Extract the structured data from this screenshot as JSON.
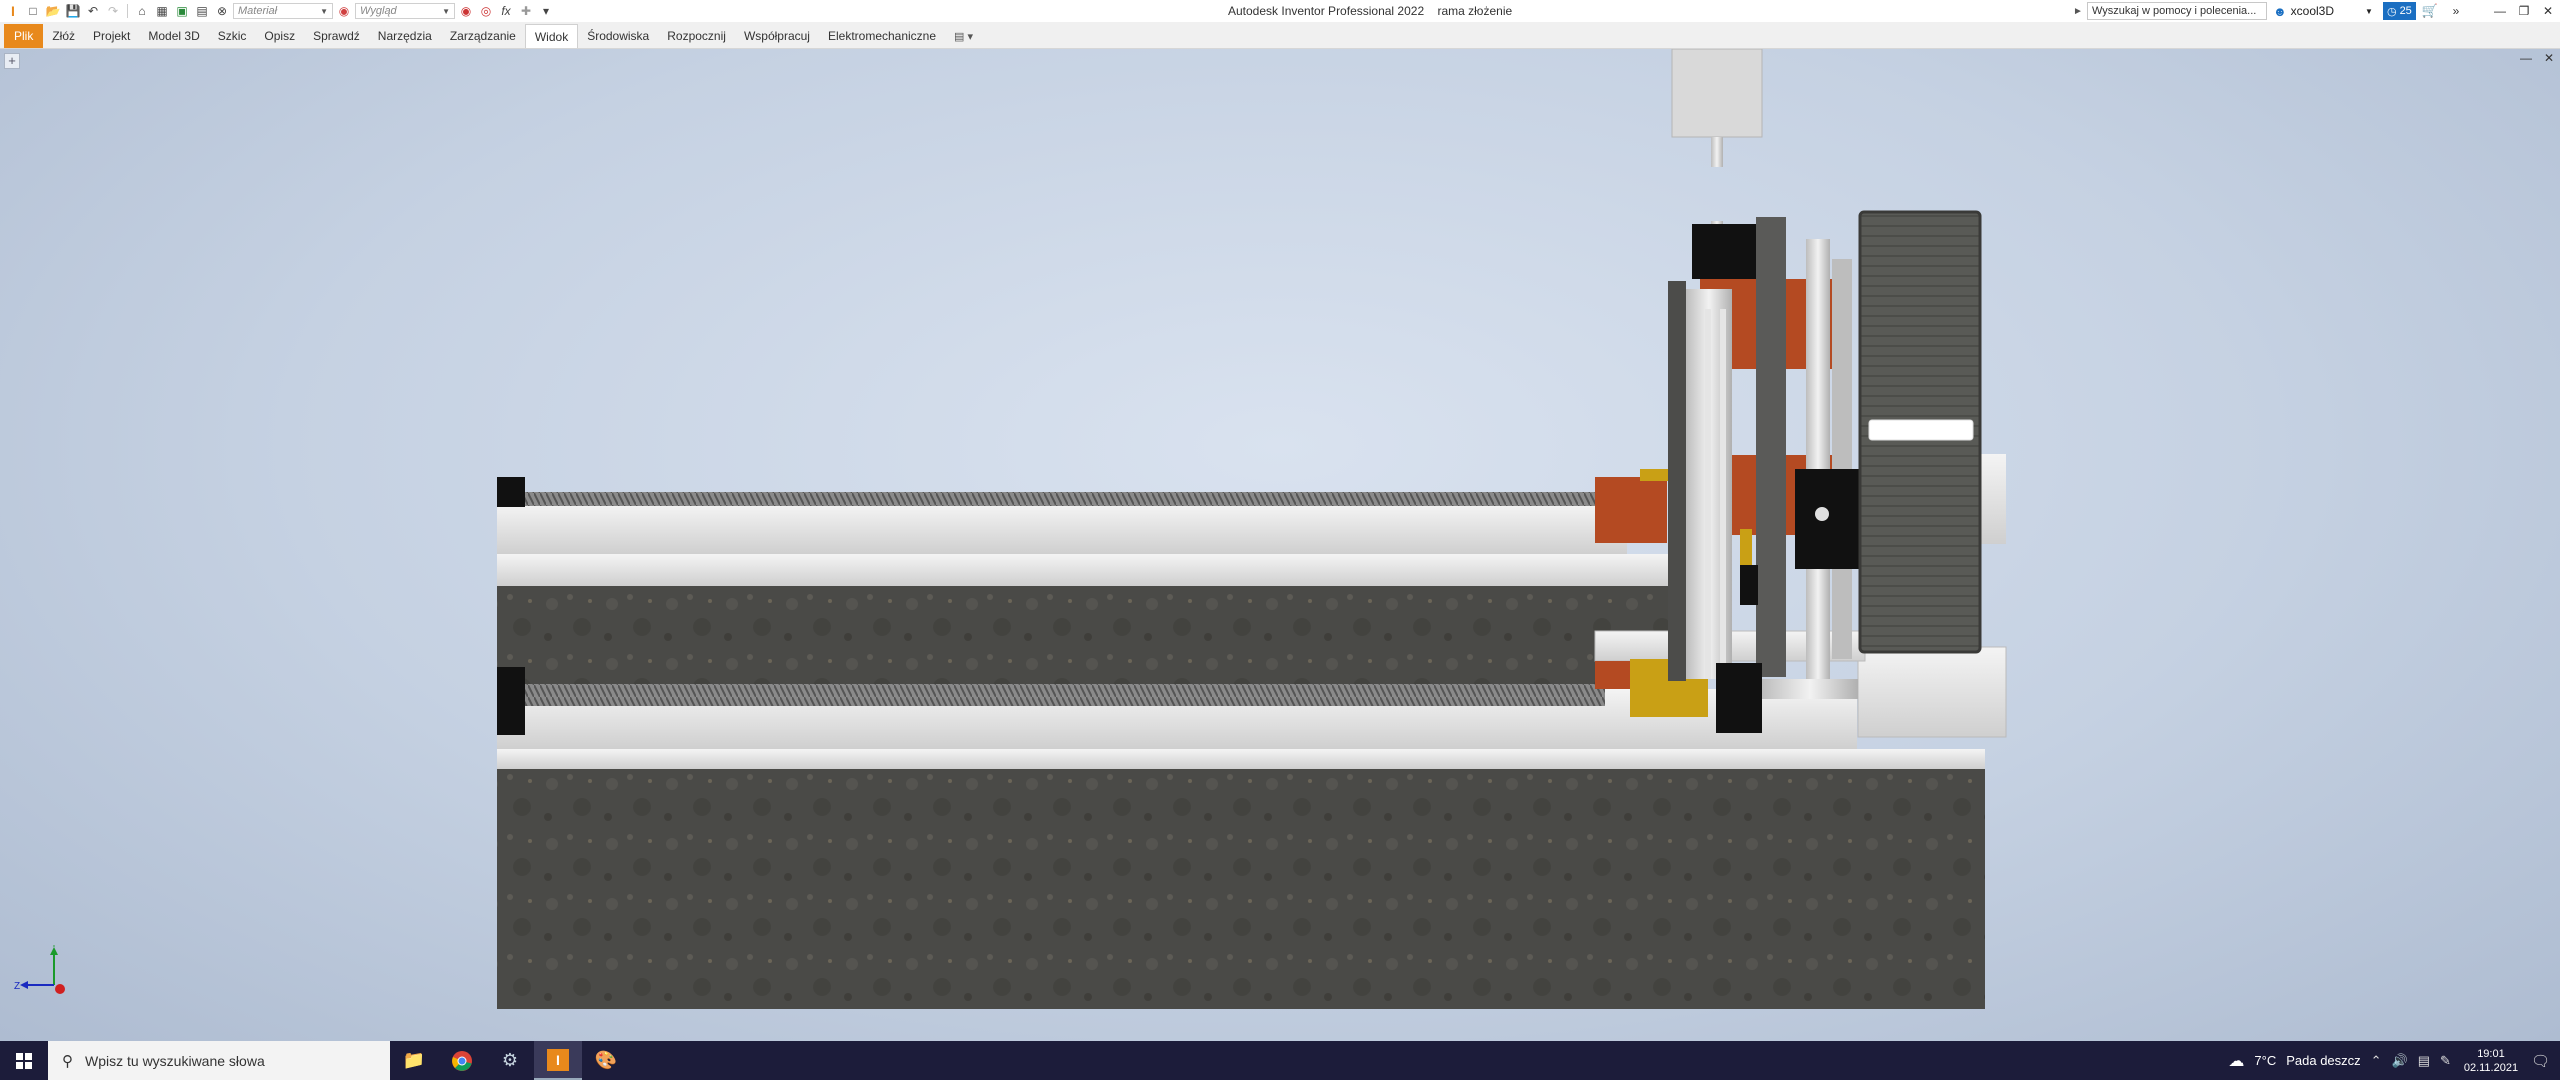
{
  "titlebar": {
    "app_name": "Autodesk Inventor Professional 2022",
    "document_name": "rama złożenie",
    "material_placeholder": "Materiał",
    "appearance_placeholder": "Wygląd",
    "help_search": "Wyszukaj w pomocy i polecenia...",
    "username": "xcool3D",
    "notifications_count": "25"
  },
  "ribbon": {
    "tabs": [
      {
        "label": "Plik"
      },
      {
        "label": "Złóż"
      },
      {
        "label": "Projekt"
      },
      {
        "label": "Model 3D"
      },
      {
        "label": "Szkic"
      },
      {
        "label": "Opisz"
      },
      {
        "label": "Sprawdź"
      },
      {
        "label": "Narzędzia"
      },
      {
        "label": "Zarządzanie"
      },
      {
        "label": "Widok"
      },
      {
        "label": "Środowiska"
      },
      {
        "label": "Rozpocznij"
      },
      {
        "label": "Współpracuj"
      },
      {
        "label": "Elektromechaniczne"
      }
    ],
    "active_tab": "Widok"
  },
  "viewport": {
    "triad": {
      "y_label": "Y",
      "z_label": "Z"
    }
  },
  "taskbar": {
    "search_placeholder": "Wpisz tu wyszukiwane słowa",
    "weather_temp": "7°C",
    "weather_text": "Pada deszcz",
    "time": "19:01",
    "date": "02.11.2021"
  },
  "colors": {
    "accent_orange": "#e8891c",
    "brand_blue": "#1b6fc2",
    "taskbar_bg": "#1c1c3a"
  }
}
